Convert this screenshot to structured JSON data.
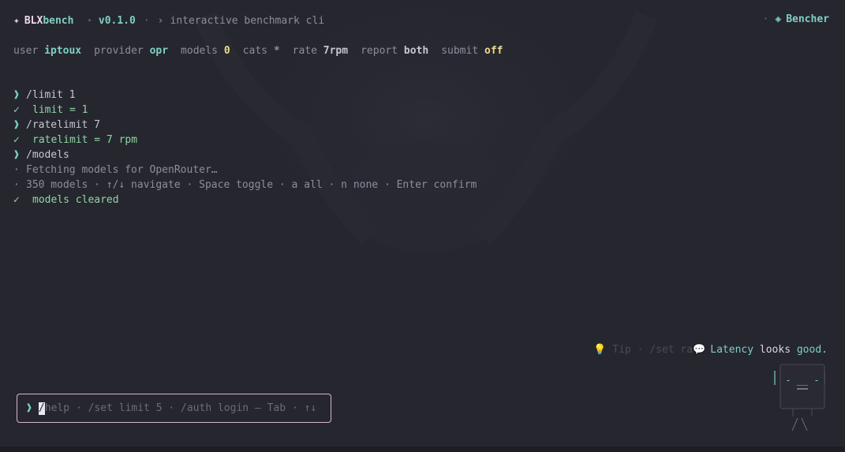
{
  "header": {
    "sparkle_icon": "sparkle-icon",
    "brand_prefix": "BLX",
    "brand_suffix": "bench",
    "triangle_icon": "triangle-right-icon",
    "version": "v0.1.0",
    "separator": "·",
    "chevron": "›",
    "tagline": "interactive benchmark cli",
    "right_separator": "·",
    "bencher_icon": "diamond-icon",
    "bencher_label": "Bencher"
  },
  "status": {
    "user_key": "user",
    "user_value": "iptoux",
    "provider_key": "provider",
    "provider_value": "opr",
    "models_key": "models",
    "models_value": "0",
    "cats_key": "cats",
    "cats_value": "*",
    "rate_key": "rate",
    "rate_value": "7rpm",
    "report_key": "report",
    "report_value": "both",
    "submit_key": "submit",
    "submit_value": "off"
  },
  "log": [
    {
      "kind": "cmd",
      "mark": "❱",
      "text": "/limit 1"
    },
    {
      "kind": "ok",
      "mark": "✓",
      "text": "limit = 1"
    },
    {
      "kind": "cmd",
      "mark": "❱",
      "text": "/ratelimit 7"
    },
    {
      "kind": "ok",
      "mark": "✓",
      "text": "ratelimit = 7 rpm"
    },
    {
      "kind": "cmd",
      "mark": "❱",
      "text": "/models"
    },
    {
      "kind": "info",
      "mark": "·",
      "text": "Fetching models for OpenRouter…"
    },
    {
      "kind": "info",
      "mark": "·",
      "text": "350 models · ↑/↓ navigate · Space toggle · a all · n none · Enter confirm"
    },
    {
      "kind": "ok",
      "mark": "✓",
      "text": "models cleared"
    }
  ],
  "tip": {
    "bulb_icon": "lightbulb-icon",
    "ghost_text": "💡 Tip · /set ra",
    "bubble_icon": "speech-bubble-icon",
    "bubble_glyph": "💬",
    "bubble_text_a": "Latency",
    "bubble_text_b": "looks",
    "bubble_text_c": "good."
  },
  "mascot": {
    "face": "- __ -"
  },
  "input": {
    "caret": "❱",
    "cursor_char": "/",
    "hint": "help · /set limit 5 · /auth login — Tab · ↑↓"
  },
  "colors": {
    "background": "#26262f",
    "accent_teal": "#7ecfc4",
    "accent_pink": "#d8b6cf",
    "success_green": "#8fd6a5",
    "value_yellow": "#f0d98c"
  }
}
